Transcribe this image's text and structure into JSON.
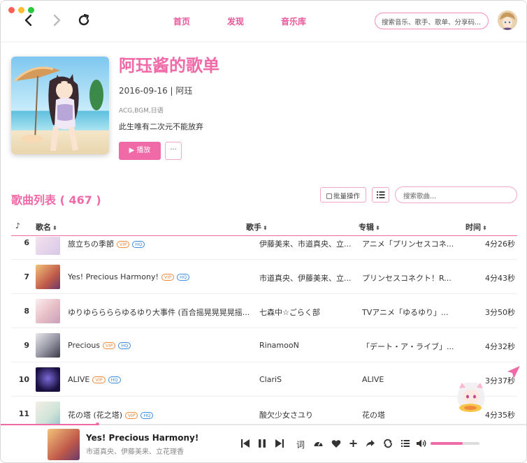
{
  "nav": {
    "links": [
      "首页",
      "发现",
      "音乐库"
    ],
    "search_placeholder": "搜索音乐、歌手、歌单、分享码..."
  },
  "playlist": {
    "title": "阿珏酱的歌单",
    "meta": "2016-09-16 | 阿珏",
    "tags": "ACG,BGM,日语",
    "description": "此生唯有二次元不能放弃",
    "play_label": "▶ 播放",
    "more_label": "···"
  },
  "song_list": {
    "title": "歌曲列表 ( 467 )",
    "batch_label": "批量操作",
    "search_placeholder": "搜索歌曲...",
    "headers": {
      "note": "♪",
      "name": "歌名",
      "artist": "歌手",
      "album": "专辑",
      "time": "时间"
    },
    "rows": [
      {
        "num": "6",
        "name": "旅立ちの季節",
        "artist": "伊藤美来、市道真央、立...",
        "album": "アニメ「プリンセスコネ...",
        "time": "4分26秒"
      },
      {
        "num": "7",
        "name": "Yes! Precious Harmony!",
        "artist": "市道真央、伊藤美来、立...",
        "album": "プリンセスコネクト！R...",
        "time": "4分43秒"
      },
      {
        "num": "8",
        "name": "ゆりゆららららゆるゆり大事件 (百合摇晃晃晃晃摇...",
        "artist": "七森中☆ごらく部",
        "album": "TVアニメ「ゆるゆり」...",
        "time": "3分50秒"
      },
      {
        "num": "9",
        "name": "Precious",
        "artist": "RinamooN",
        "album": "「デート・ア・ライブ」...",
        "time": "4分32秒"
      },
      {
        "num": "10",
        "name": "ALIVE",
        "artist": "ClariS",
        "album": "ALIVE",
        "time": "3分37秒"
      },
      {
        "num": "11",
        "name": "花の塔 (花之塔)",
        "artist": "酸欠少女さユり",
        "album": "花の塔",
        "time": "4分35秒"
      }
    ],
    "badges": {
      "vip": "VIP",
      "hq": "HQ"
    }
  },
  "player": {
    "title": "Yes! Precious Harmony!",
    "artist": "市道真央、伊藤美来、立花理香",
    "lyrics_label": "词",
    "progress": 0.18,
    "volume": 0.66
  },
  "colors": {
    "accent": "#f06aa8",
    "vip": "#f08a3c",
    "hq": "#3c8ddc"
  }
}
